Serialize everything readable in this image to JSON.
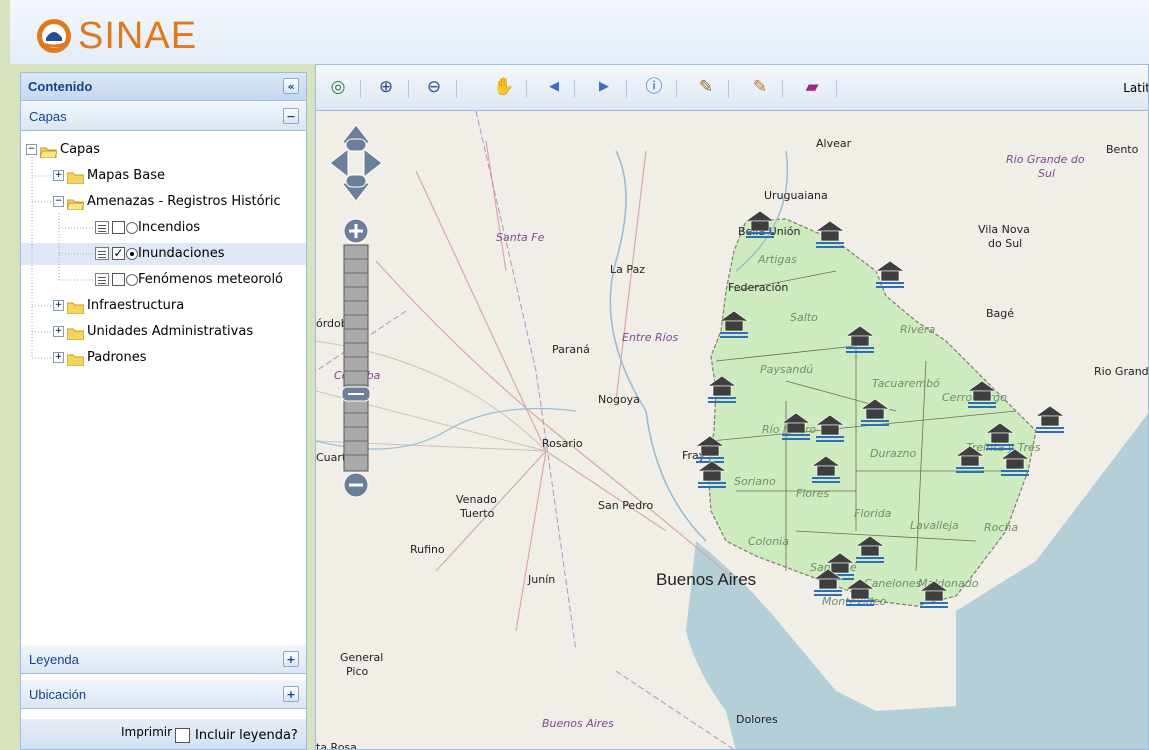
{
  "app": {
    "title": "SINAE"
  },
  "sidebar": {
    "contenido_title": "Contenido",
    "collapse_icon": "«",
    "capas_section": "Capas",
    "leyenda_section": "Leyenda",
    "ubicacion_section": "Ubicación",
    "print_label": "Imprimir",
    "include_legend_label": "Incluir leyenda?"
  },
  "tree": {
    "root": "Capas",
    "mapas_base": "Mapas Base",
    "amenazas": "Amenazas - Registros Históric",
    "incendios": "Incendios",
    "inundaciones": "Inundaciones",
    "fenomenos": "Fenómenos meteoroló",
    "infraestructura": "Infraestructura",
    "unidades": "Unidades Administrativas",
    "padrones": "Padrones"
  },
  "toolbar": {
    "icons": [
      "globe-icon",
      "zoom-in-icon",
      "zoom-out-icon",
      "pan-hand-icon",
      "back-arrow-icon",
      "forward-arrow-icon",
      "info-icon",
      "measure-line-icon",
      "measure-area-icon",
      "book-icon"
    ],
    "lat_label": "Latit"
  },
  "map": {
    "cities": [
      "Alvear",
      "Bento",
      "Uruguaiana",
      "Vila Nova",
      "do Sul",
      "Bella Unión",
      "La Paz",
      "Federación",
      "Bagé",
      "Paraná",
      "Rio Grand",
      "Nogoya",
      "Rosario",
      "Fray",
      "Venado",
      "Tuerto",
      "San Pedro",
      "Rufino",
      "Junín",
      "Buenos Aires",
      "General",
      "Pico",
      "Dolores",
      "ta Rosa",
      "Cuarto",
      "órdoba"
    ],
    "provinces": [
      "Santa Fe",
      "Entre Ríos",
      "Córdoba",
      "Buenos Aires",
      "Rio Grande do",
      "Sul"
    ],
    "departments": [
      "Artigas",
      "Salto",
      "Rivera",
      "Paysandú",
      "Tacuarembó",
      "Cerro Largo",
      "Río Negro",
      "Durazno",
      "Treinta y Tres",
      "Soriano",
      "Flores",
      "Florida",
      "Lavalleja",
      "Rocha",
      "Colonia",
      "San José",
      "Canelones",
      "Maldonado",
      "Montevideo"
    ],
    "colors": {
      "uruguay_fill": "#cdebbe",
      "water": "#b4cfd8",
      "land": "#f1eee8",
      "roads": "#d8a8a8"
    }
  }
}
